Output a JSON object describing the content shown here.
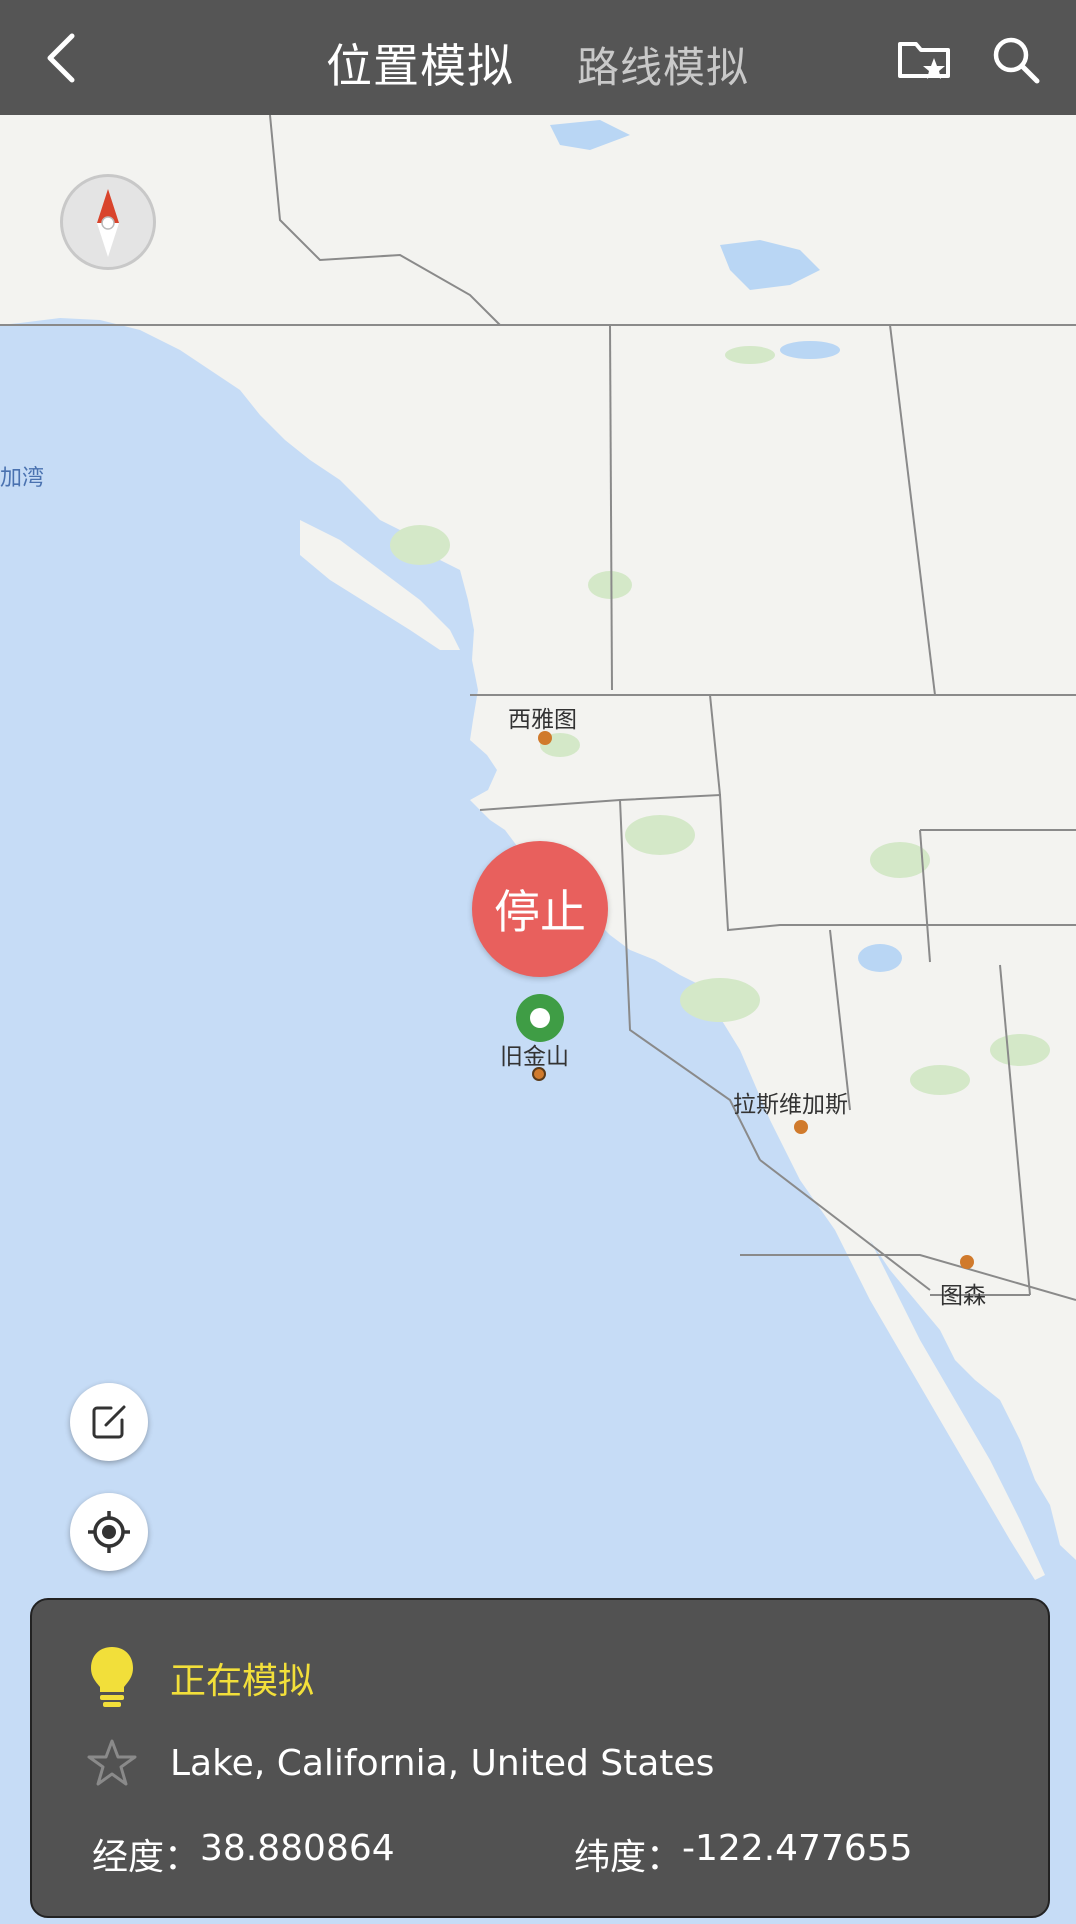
{
  "header": {
    "title": "位置模拟",
    "route_tab": "路线模拟",
    "icons": [
      "back-icon",
      "favorite-folder-icon",
      "search-icon"
    ]
  },
  "map": {
    "labels": {
      "bay": "加湾",
      "seattle": "西雅图",
      "sf": "旧金山",
      "vegas": "拉斯维加斯",
      "tucson": "图森"
    },
    "stop_button": "停止",
    "colors": {
      "water": "#c6dcf6",
      "land": "#f3f3f0",
      "park": "#d4e8c8",
      "city_dot": "#d07a2c",
      "marker": "#3f9d45",
      "stop": "#e8605d"
    }
  },
  "panel": {
    "status": "正在模拟",
    "address": "Lake, California, United States",
    "lng_label": "经度：",
    "lng_value": "38.880864",
    "lat_label": "纬度：",
    "lat_value": "-122.477655"
  }
}
